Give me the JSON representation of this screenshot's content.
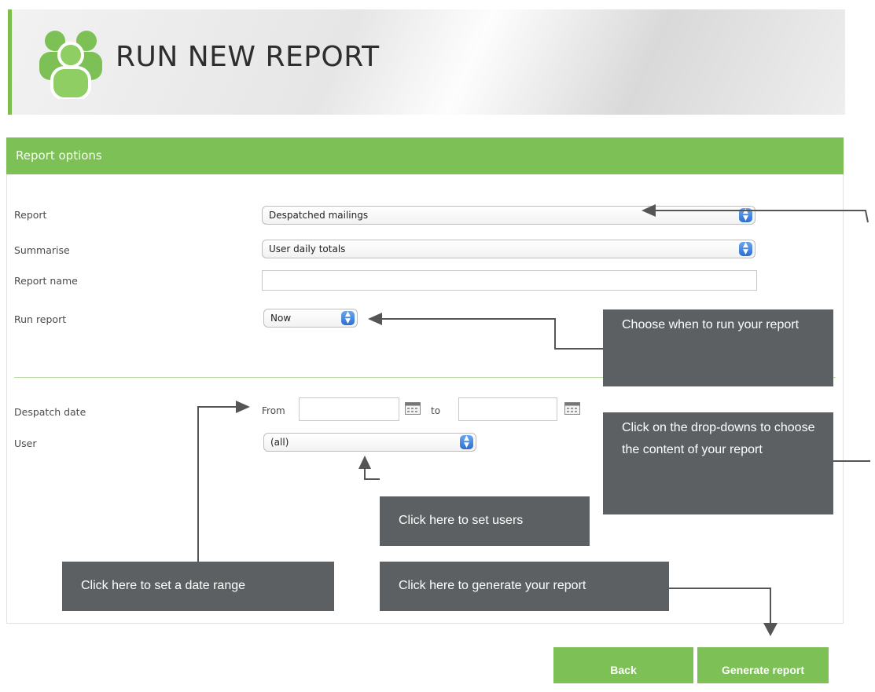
{
  "header": {
    "title": "RUN NEW REPORT",
    "icon": "users-group-icon"
  },
  "panel": {
    "title": "Report options"
  },
  "form": {
    "report": {
      "label": "Report",
      "value": "Despatched mailings"
    },
    "summarise": {
      "label": "Summarise",
      "value": "User daily totals"
    },
    "report_name": {
      "label": "Report name",
      "value": ""
    },
    "run_report": {
      "label": "Run report",
      "value": "Now"
    },
    "despatch_date": {
      "label": "Despatch date",
      "from_label": "From",
      "to_label": "to",
      "from_value": "",
      "to_value": ""
    },
    "user": {
      "label": "User",
      "value": "(all)"
    }
  },
  "callouts": {
    "run_when": "Choose when to run your report",
    "dropdowns": "Click on the drop-downs to choose the content of your report",
    "set_users": "Click here to set users",
    "date_range": "Click here to set a date range",
    "generate": "Click here to generate your report"
  },
  "buttons": {
    "back": "Back",
    "generate": "Generate report"
  },
  "colors": {
    "accent_green": "#7dc055",
    "callout_gray": "#5c6062",
    "select_blue": "#3b7fdc"
  }
}
